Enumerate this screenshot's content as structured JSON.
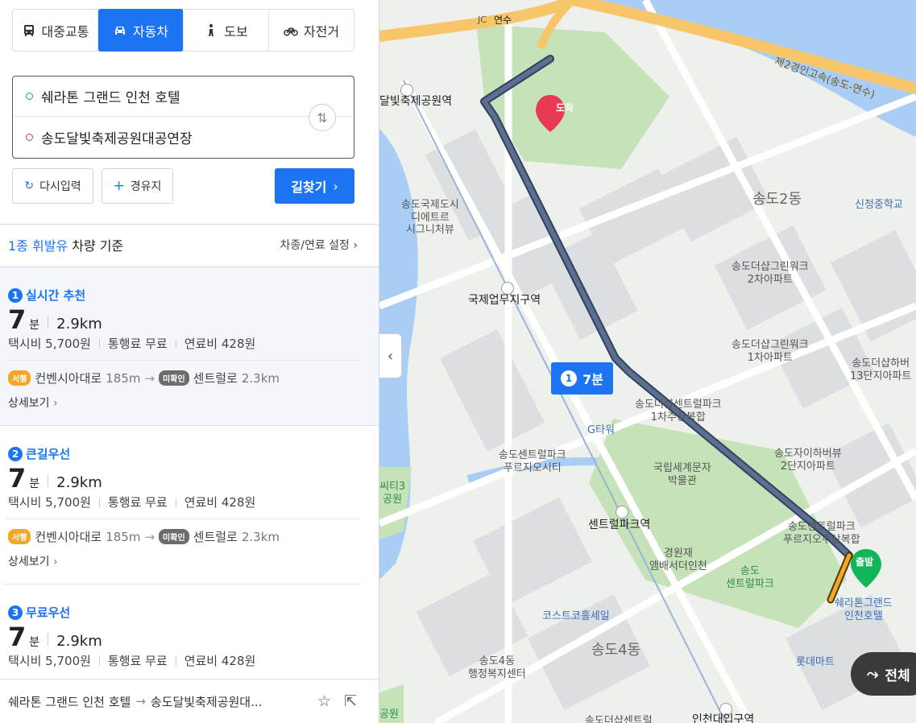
{
  "modes": [
    {
      "label": "대중교통",
      "icon": "bus-icon"
    },
    {
      "label": "자동차",
      "icon": "car-icon"
    },
    {
      "label": "도보",
      "icon": "walk-icon"
    },
    {
      "label": "자전거",
      "icon": "bicycle-icon"
    }
  ],
  "route": {
    "start": "쉐라톤 그랜드 인천 호텔",
    "goal": "송도달빛축제공원대공연장"
  },
  "actions": {
    "reset": "다시입력",
    "waypoint": "경유지",
    "search": "길찾기"
  },
  "fuel": {
    "type": "1종 휘발유",
    "suffix": "차량 기준",
    "settings": "차종/연료 설정"
  },
  "routes": [
    {
      "num": "1",
      "title": "실시간 추천",
      "minutes": "7",
      "unit": "분",
      "distance": "2.9km",
      "taxi": "택시비 5,700원",
      "toll": "통행료 무료",
      "fuelcost": "연료비 428원",
      "tag1": "서행",
      "road1": "컨벤시아대로",
      "dist1": "185m",
      "tag2": "미확인",
      "road2": "센트럴로",
      "dist2": "2.3km",
      "more": "상세보기"
    },
    {
      "num": "2",
      "title": "큰길우선",
      "minutes": "7",
      "unit": "분",
      "distance": "2.9km",
      "taxi": "택시비 5,700원",
      "toll": "통행료 무료",
      "fuelcost": "연료비 428원",
      "tag1": "서행",
      "road1": "컨벤시아대로",
      "dist1": "185m",
      "tag2": "미확인",
      "road2": "센트럴로",
      "dist2": "2.3km",
      "more": "상세보기"
    },
    {
      "num": "3",
      "title": "무료우선",
      "minutes": "7",
      "unit": "분",
      "distance": "2.9km",
      "taxi": "택시비 5,700원",
      "toll": "통행료 무료",
      "fuelcost": "연료비 428원"
    }
  ],
  "footer": {
    "from": "쉐라톤 그랜드 인천 호텔",
    "arrow": "→",
    "to": "송도달빛축제공원대..."
  },
  "map": {
    "badge_num": "1",
    "badge_time": "7분",
    "arrive": "도착",
    "depart": "출발",
    "fab": "전체",
    "labels": {
      "yeonsu": "연수",
      "jc": "JC",
      "highway": "제2경인고속(송도-연수)",
      "dalbit_station": "달빛축제공원역",
      "songdo_city": "송도국제도시\n디에트르\n시그니처뷰",
      "songdo2": "송도2동",
      "sinjeong": "신정중학교",
      "greenwork2": "송도더샵그린워크\n2차아파트",
      "greenwork1": "송도더샵그린워크\n1차아파트",
      "harbor13": "송도더샵하버\n13단지아파트",
      "intl_station": "국제업무지구역",
      "centralpark1": "송도더샵센트럴파크\n1차주상복합",
      "gtower": "G타워",
      "harbor2": "송도자이하버뷰\n2단지아파트",
      "prugio_city": "송도센트럴파크\n푸르지오시티",
      "museum": "국립세계문자\n박물관",
      "city3": "씨티3\n공원",
      "centralpark_station": "센트럴파크역",
      "prugio_complex": "송도센트럴파크\n푸르지오주상복합",
      "gyeongwonjae": "경원재\n앰배서더인천",
      "songdo_park": "송도\n센트럴파크",
      "sheraton": "쉐라톤그랜드\n인천호텔",
      "costco": "코스트코홀세일",
      "songdo4": "송도4동",
      "office4": "송도4동\n행정복지센터",
      "lottemart": "롯데마트",
      "inu_station": "인천대입구역",
      "park_bottom": "공원",
      "songdo_bottom": "송도더샵센트럴"
    }
  }
}
